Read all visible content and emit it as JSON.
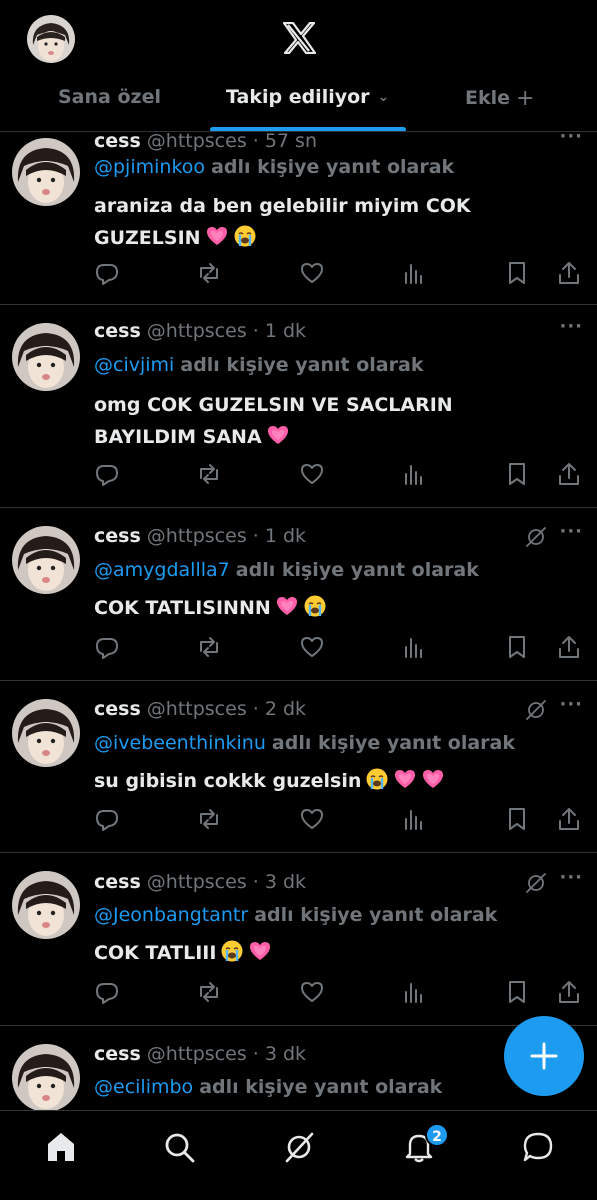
{
  "header": {
    "tabs": [
      {
        "label": "Sana özel"
      },
      {
        "label": "Takip ediliyor"
      },
      {
        "label": "Ekle"
      }
    ]
  },
  "tweets": [
    {
      "name": "cess",
      "handle": "@httpsces",
      "time": "57 sn",
      "reply_to": "@pjiminkoo",
      "reply_suffix": "adlı kişiye yanıt olarak",
      "lines": [
        "araniza da ben gelebilir miyim COK",
        "GUZELSIN"
      ],
      "line_emojis": [
        [],
        [
          "heart",
          "cry"
        ]
      ],
      "grok_icon": false
    },
    {
      "name": "cess",
      "handle": "@httpsces",
      "time": "1 dk",
      "reply_to": "@civjimi",
      "reply_suffix": "adlı kişiye yanıt olarak",
      "lines": [
        "omg COK GUZELSIN VE SACLARIN",
        "BAYILDIM SANA"
      ],
      "line_emojis": [
        [],
        [
          "heart"
        ]
      ],
      "grok_icon": false
    },
    {
      "name": "cess",
      "handle": "@httpsces",
      "time": "1 dk",
      "reply_to": "@amygdallla7",
      "reply_suffix": "adlı kişiye yanıt olarak",
      "lines": [
        "COK TATLISINNN"
      ],
      "line_emojis": [
        [
          "heart",
          "cry"
        ]
      ],
      "grok_icon": true
    },
    {
      "name": "cess",
      "handle": "@httpsces",
      "time": "2 dk",
      "reply_to": "@ivebeenthinkinu",
      "reply_suffix": "adlı kişiye yanıt olarak",
      "lines": [
        "su gibisin cokkk guzelsin"
      ],
      "line_emojis": [
        [
          "cry",
          "heart",
          "heart"
        ]
      ],
      "grok_icon": true
    },
    {
      "name": "cess",
      "handle": "@httpsces",
      "time": "3 dk",
      "reply_to": "@Jeonbangtantr",
      "reply_suffix": "adlı kişiye yanıt olarak",
      "lines": [
        "COK TATLIII"
      ],
      "line_emojis": [
        [
          "cry",
          "heart"
        ]
      ],
      "grok_icon": true
    },
    {
      "name": "cess",
      "handle": "@httpsces",
      "time": "3 dk",
      "reply_to": "@ecilimbo",
      "reply_suffix": "adlı kişiye yanıt olarak",
      "lines": [],
      "line_emojis": [],
      "grok_icon": false
    }
  ],
  "bottom_nav": {
    "items": [
      "home-icon",
      "search-icon",
      "grok-icon",
      "notifications-icon",
      "messages-icon"
    ],
    "notification_count": "2"
  },
  "colors": {
    "accent": "#1d9bf0",
    "background": "#000000",
    "text": "#e7e9ea",
    "muted": "#71767b",
    "divider": "#2f3336"
  }
}
